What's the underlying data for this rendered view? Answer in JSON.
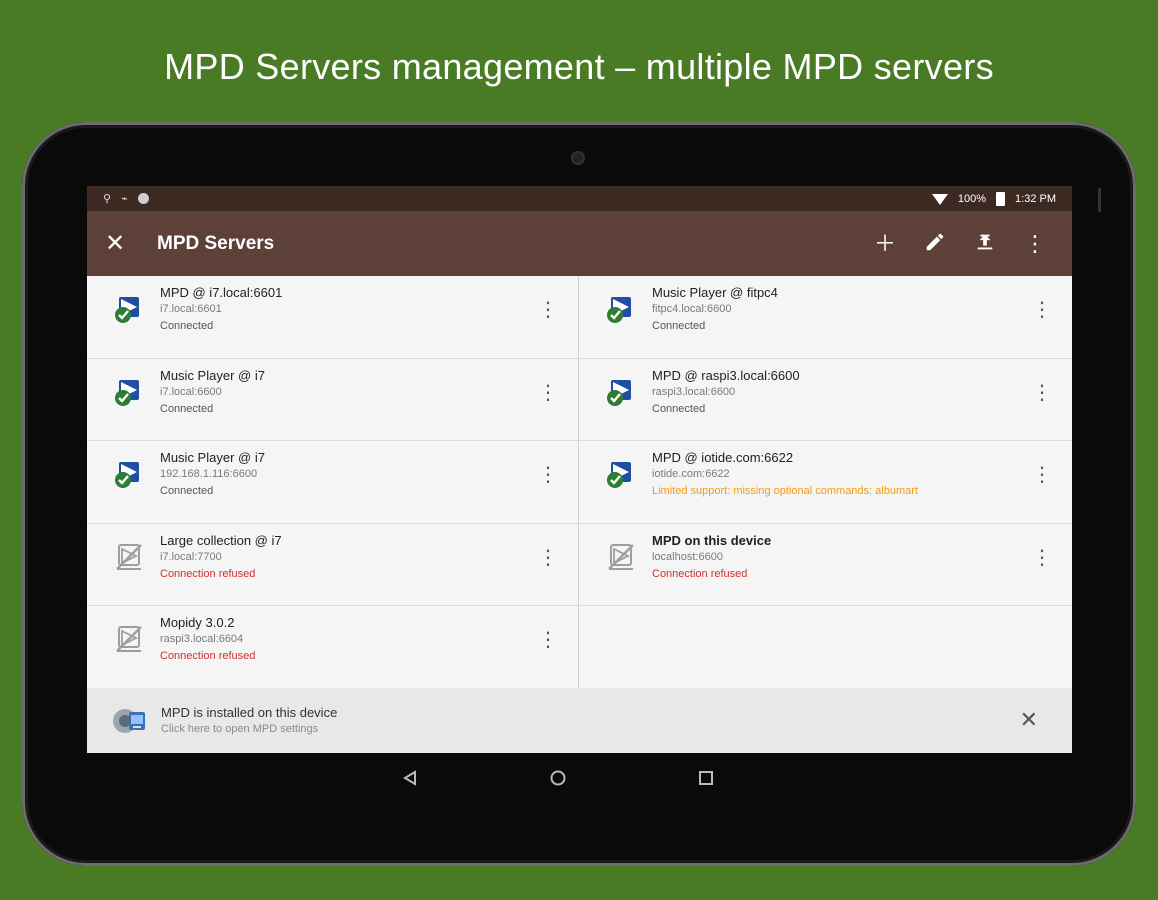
{
  "promo": {
    "title": "MPD Servers management – multiple MPD servers"
  },
  "status_bar": {
    "left_icons": [
      "usb-icon",
      "vibrate-icon",
      "circle-icon"
    ],
    "battery_text": "100%",
    "time": "1:32 PM"
  },
  "app_bar": {
    "close_icon": "close-icon",
    "title": "MPD Servers",
    "actions": [
      "add-icon",
      "edit-icon",
      "upload-icon",
      "overflow-icon"
    ]
  },
  "servers": [
    {
      "name": "MPD @ i7.local:6601",
      "address": "i7.local:6601",
      "status": "Connected",
      "kind": "ok"
    },
    {
      "name": "Music Player @ fitpc4",
      "address": "fitpc4.local:6600",
      "status": "Connected",
      "kind": "ok"
    },
    {
      "name": "Music Player @ i7",
      "address": "i7.local:6600",
      "status": "Connected",
      "kind": "ok"
    },
    {
      "name": "MPD @ raspi3.local:6600",
      "address": "raspi3.local:6600",
      "status": "Connected",
      "kind": "ok"
    },
    {
      "name": "Music Player @ i7",
      "address": "192.168.1.116:6600",
      "status": "Connected",
      "kind": "ok"
    },
    {
      "name": "MPD @ iotide.com:6622",
      "address": "iotide.com:6622",
      "status": "Limited support: missing optional commands: albumart",
      "kind": "warn"
    },
    {
      "name": "Large collection  @ i7",
      "address": "i7.local:7700",
      "status": "Connection refused",
      "kind": "err"
    },
    {
      "name": "MPD on this device",
      "address": "localhost:6600",
      "status": "Connection refused",
      "kind": "err",
      "bold": true
    },
    {
      "name": "Mopidy 3.0.2",
      "address": "raspi3.local:6604",
      "status": "Connection refused",
      "kind": "err"
    }
  ],
  "banner": {
    "title": "MPD is installed on this device",
    "subtitle": "Click here to open MPD settings"
  },
  "colors": {
    "background": "#497a24",
    "status_bar": "#3c2a22",
    "app_bar": "#5d4037",
    "connected_check": "#2e7d32",
    "error_text": "#d32f2f",
    "warning_text": "#f39c12"
  }
}
